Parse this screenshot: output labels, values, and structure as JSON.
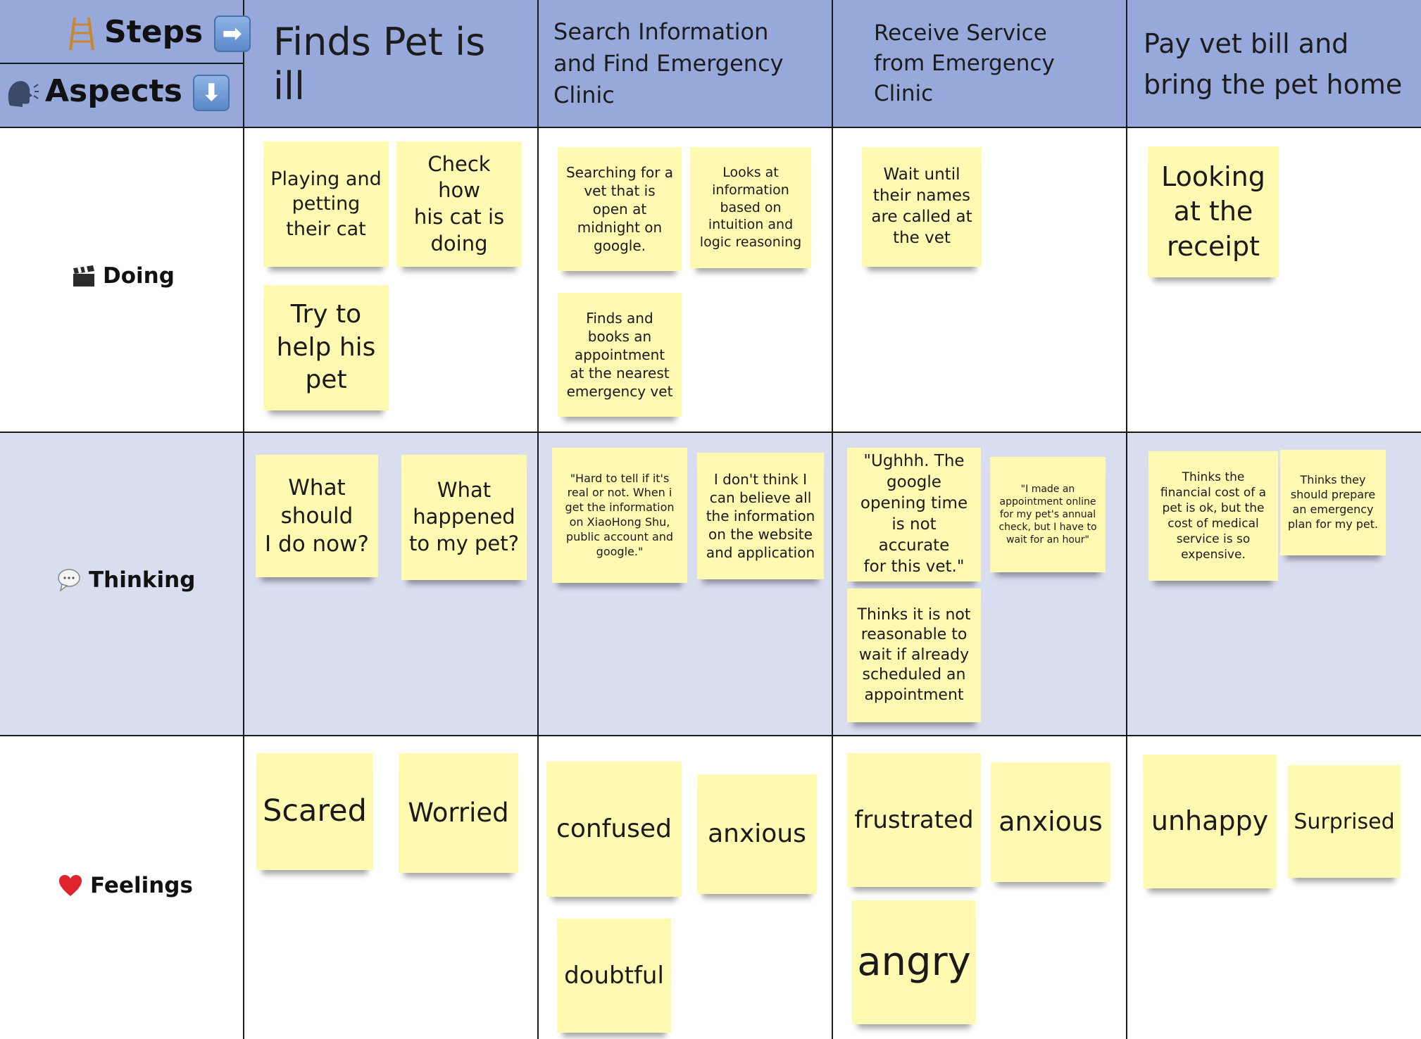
{
  "header": {
    "steps_label": "Steps",
    "aspects_label": "Aspects",
    "steps_icon": "ladder-icon",
    "steps_arrow_icon": "arrow-right-icon",
    "aspects_icon": "speaking-head-icon",
    "aspects_arrow_icon": "arrow-down-icon"
  },
  "steps": [
    "Finds Pet is ill",
    "Search Information and Find Emergency Clinic",
    "Receive Service from Emergency Clinic",
    "Pay vet bill and bring the pet home"
  ],
  "aspects": [
    {
      "label": "Doing",
      "icon": "clapper-board-icon"
    },
    {
      "label": "Thinking",
      "icon": "speech-bubble-icon"
    },
    {
      "label": "Feelings",
      "icon": "heart-icon"
    }
  ],
  "notes": {
    "doing": {
      "step1": [
        "Playing and\npetting\ntheir cat",
        "Check how\nhis cat is\ndoing",
        "Try to\nhelp his\npet"
      ],
      "step2": [
        "Searching for a\nvet that is\nopen at\nmidnight on\ngoogle.",
        "Looks at\ninformation\nbased on\nintuition and\nlogic reasoning",
        "Finds and\nbooks an\nappointment\nat the nearest\nemergency vet"
      ],
      "step3": [
        "Wait until\ntheir names\nare called at\nthe vet"
      ],
      "step4": [
        "Looking\nat the\nreceipt"
      ]
    },
    "thinking": {
      "step1": [
        "What\nshould\nI do now?",
        "What\nhappened\nto my pet?"
      ],
      "step2": [
        "\"Hard to tell if it's\nreal or not. When i\nget the information\non XiaoHong Shu,\npublic account and\ngoogle.\"",
        "I don't think I\ncan believe all\nthe information\non the website\nand application"
      ],
      "step3": [
        "\"Ughhh. The\ngoogle\nopening time\nis not accurate\nfor this vet.\"",
        "\"I made an\nappointment online\nfor my pet's annual\ncheck, but I have to\nwait for an hour\"",
        "Thinks it is not\nreasonable to\nwait if already\nscheduled an\nappointment"
      ],
      "step4": [
        "Thinks the\nfinancial cost of a\npet is ok, but the\ncost of medical\nservice is so\nexpensive.",
        "Thinks they\nshould prepare\nan emergency\nplan for my pet."
      ]
    },
    "feelings": {
      "step1": [
        "Scared",
        "Worried"
      ],
      "step2": [
        "confused",
        "anxious",
        "doubtful"
      ],
      "step3": [
        "frustrated",
        "anxious",
        "angry"
      ],
      "step4": [
        "unhappy",
        "Surprised"
      ]
    }
  },
  "colors": {
    "header_bg": "#96a9da",
    "thinking_row_bg": "#d9ddf0",
    "sticky_note": "#fff9b1",
    "grid_line": "#1a1a1a"
  }
}
